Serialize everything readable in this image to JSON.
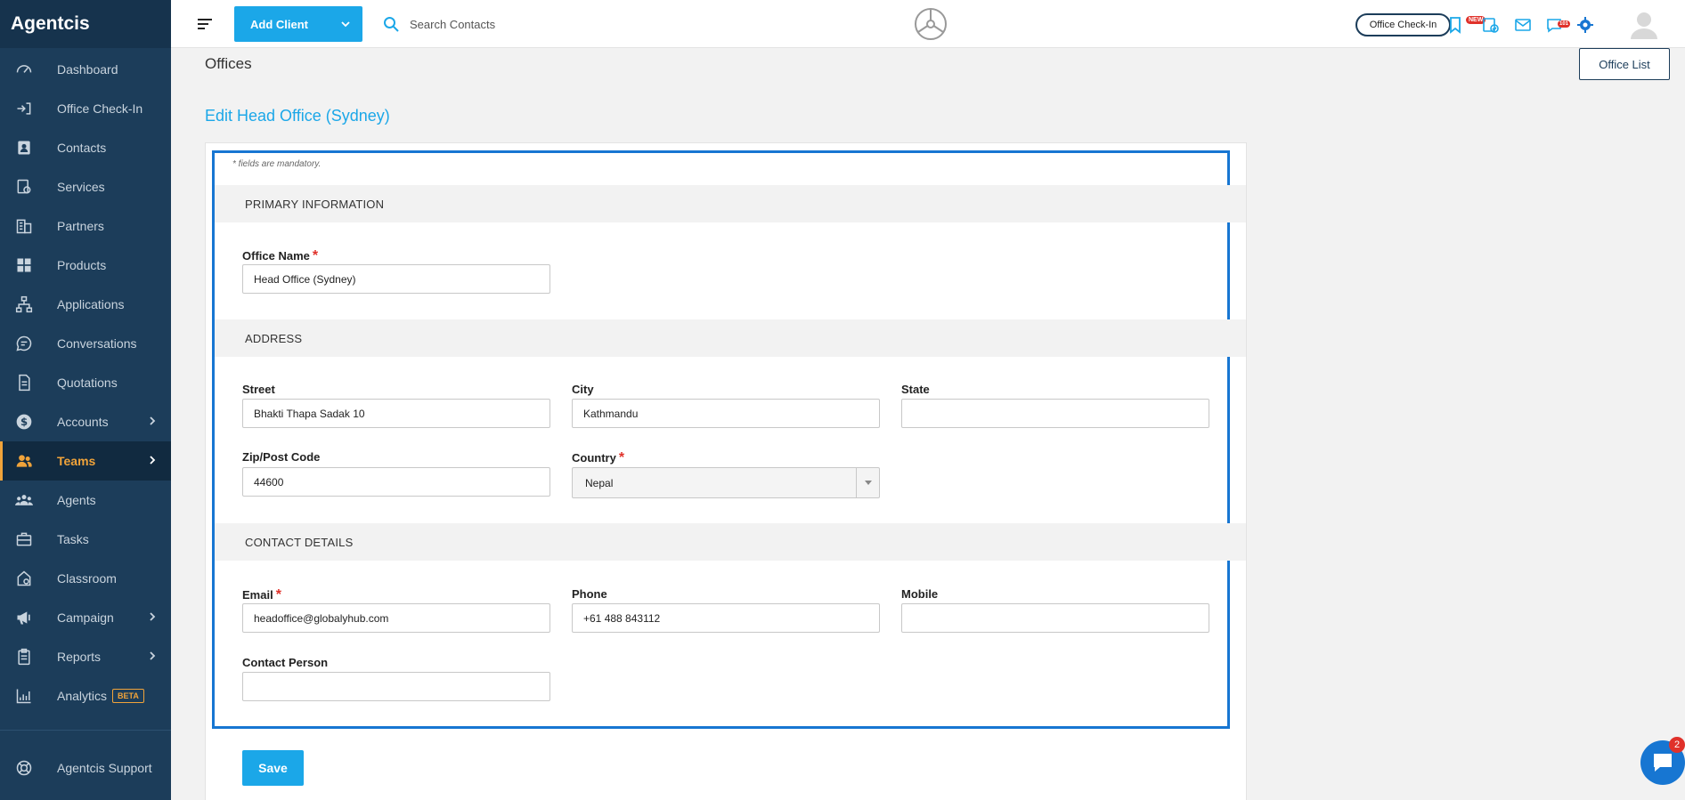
{
  "sidebar": {
    "brand": "Agentcis",
    "items": [
      {
        "label": "Dashboard",
        "icon": "gauge-icon"
      },
      {
        "label": "Office Check-In",
        "icon": "checkin-icon"
      },
      {
        "label": "Contacts",
        "icon": "contacts-icon"
      },
      {
        "label": "Services",
        "icon": "services-icon"
      },
      {
        "label": "Partners",
        "icon": "building-icon"
      },
      {
        "label": "Products",
        "icon": "products-icon"
      },
      {
        "label": "Applications",
        "icon": "flow-icon"
      },
      {
        "label": "Conversations",
        "icon": "chat-icon"
      },
      {
        "label": "Quotations",
        "icon": "document-icon"
      },
      {
        "label": "Accounts",
        "icon": "dollar-icon"
      },
      {
        "label": "Teams",
        "icon": "team-icon"
      },
      {
        "label": "Agents",
        "icon": "agents-icon"
      },
      {
        "label": "Tasks",
        "icon": "briefcase-icon"
      },
      {
        "label": "Classroom",
        "icon": "classroom-icon"
      },
      {
        "label": "Campaign",
        "icon": "megaphone-icon"
      },
      {
        "label": "Reports",
        "icon": "clipboard-icon"
      },
      {
        "label": "Analytics",
        "icon": "analytics-icon"
      }
    ],
    "beta_badge": "BETA",
    "support": "Agentcis Support"
  },
  "topbar": {
    "add_client": "Add Client",
    "search_placeholder": "Search Contacts",
    "checkin_button": "Office Check-In",
    "new_badge": "NEW",
    "notification_count": "101"
  },
  "main": {
    "page_title": "Offices",
    "office_list_button": "Office List",
    "edit_title": "Edit Head Office (Sydney)",
    "mandatory_note": "* fields are mandatory.",
    "sections": {
      "primary": "PRIMARY INFORMATION",
      "address": "ADDRESS",
      "contact": "CONTACT DETAILS"
    },
    "fields": {
      "office_name": {
        "label": "Office Name",
        "value": "Head Office (Sydney)"
      },
      "street": {
        "label": "Street",
        "value": "Bhakti Thapa Sadak 10"
      },
      "city": {
        "label": "City",
        "value": "Kathmandu"
      },
      "state": {
        "label": "State",
        "value": ""
      },
      "zip": {
        "label": "Zip/Post Code",
        "value": "44600"
      },
      "country": {
        "label": "Country",
        "value": "Nepal"
      },
      "email": {
        "label": "Email",
        "value": "headoffice@globalyhub.com"
      },
      "phone": {
        "label": "Phone",
        "value": "+61 488 843112"
      },
      "mobile": {
        "label": "Mobile",
        "value": ""
      },
      "contact_person": {
        "label": "Contact Person",
        "value": ""
      }
    },
    "required_mark": "*",
    "save_button": "Save"
  },
  "chat": {
    "unread": "2"
  },
  "colors": {
    "sidebar": "#1c3d5a",
    "accent": "#1ba7e8",
    "active": "#f0a33a",
    "frame": "#1776d2",
    "required": "#e0312a"
  }
}
